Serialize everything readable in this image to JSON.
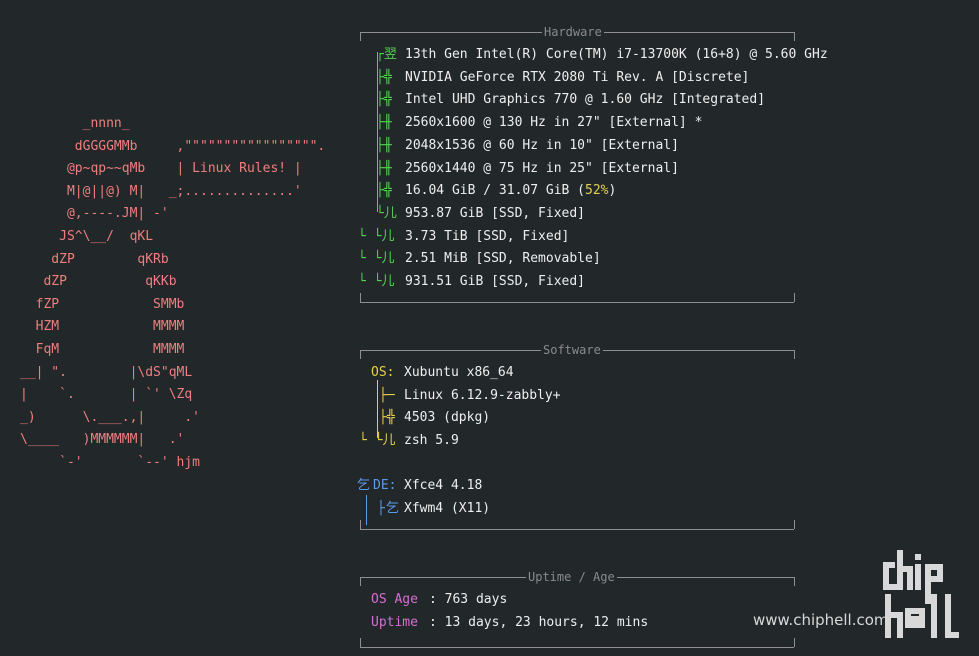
{
  "ascii_art": [
    "        _nnnn_",
    "       dGGGGMMb     ,\"\"\"\"\"\"\"\"\"\"\"\"\"\"\"\"\".",
    "      @p~qp~~qMb    | Linux Rules! |",
    "      M|@||@) M|   _;..............'",
    "      @,----.JM| -'",
    "     JS^\\__/  qKL",
    "    dZP        qKRb",
    "   dZP          qKKb",
    "  fZP            SMMb",
    "  HZM            MMMM",
    "  FqM            MMMM",
    "__| \".        |\\dS\"qML",
    "|    `.       | `' \\Zq",
    "_)      \\.___.,|     .'",
    "\\____   )MMMMMM|   .'",
    "     `-'       `--' hjm"
  ],
  "hardware": {
    "title": "Hardware",
    "rows": [
      {
        "icon": "cpu-icon",
        "glyph": "翌",
        "text": "13th Gen Intel(R) Core(TM) i7-13700K (16+8) @ 5.60 GHz"
      },
      {
        "icon": "gpu-icon",
        "glyph": "╬",
        "text": "NVIDIA GeForce RTX 2080 Ti Rev. A [Discrete]"
      },
      {
        "icon": "gpu-icon",
        "glyph": "╬",
        "text": "Intel UHD Graphics 770 @ 1.60 GHz [Integrated]"
      },
      {
        "icon": "display-icon",
        "glyph": "╫",
        "text": "2560x1600 @ 130 Hz in 27\" [External] *"
      },
      {
        "icon": "display-icon",
        "glyph": "╫",
        "text": "2048x1536 @ 60 Hz in 10\" [External]"
      },
      {
        "icon": "display-icon",
        "glyph": "╫",
        "text": "2560x1440 @ 75 Hz in 25\" [External]"
      },
      {
        "icon": "memory-icon",
        "glyph": "╬",
        "text": "16.04 GiB / 31.07 GiB (",
        "highlight": "52%",
        "after": ")"
      },
      {
        "icon": "disk-icon",
        "glyph": "儿",
        "text": "953.87 GiB [SSD, Fixed]"
      },
      {
        "icon": "disk-icon",
        "glyph": "儿",
        "text": "3.73 TiB [SSD, Fixed]"
      },
      {
        "icon": "disk-icon",
        "glyph": "儿",
        "text": "2.51 MiB [SSD, Removable]"
      },
      {
        "icon": "disk-icon",
        "glyph": "儿",
        "text": "931.51 GiB [SSD, Fixed]"
      }
    ]
  },
  "software": {
    "title": "Software",
    "os_label": "OS:",
    "os_value": "Xubuntu x86_64",
    "kernel_value": "Linux 6.12.9-zabbly+",
    "packages_value": "4503 (dpkg)",
    "shell_value": "zsh 5.9",
    "de_glyph": "乞",
    "de_label": "DE:",
    "de_value": "Xfce4 4.18",
    "wm_glyph": "乞",
    "wm_value": "Xfwm4 (X11)"
  },
  "uptime": {
    "title": "Uptime / Age",
    "os_age_label": "OS Age",
    "os_age_value": ": 763 days",
    "uptime_label": "Uptime",
    "uptime_value": ": 13 days, 23 hours, 12 mins"
  },
  "watermark": {
    "text": "www.chiphell.com",
    "logo_text": "chip hell"
  },
  "colors": {
    "background": "#22282a",
    "ascii": "#f07e7e",
    "hardware_accent": "#55d055",
    "software_accent": "#e5cf4a",
    "de_accent": "#5d9ae8",
    "uptime_accent": "#d46ed2",
    "frame": "#8f8f8f"
  }
}
